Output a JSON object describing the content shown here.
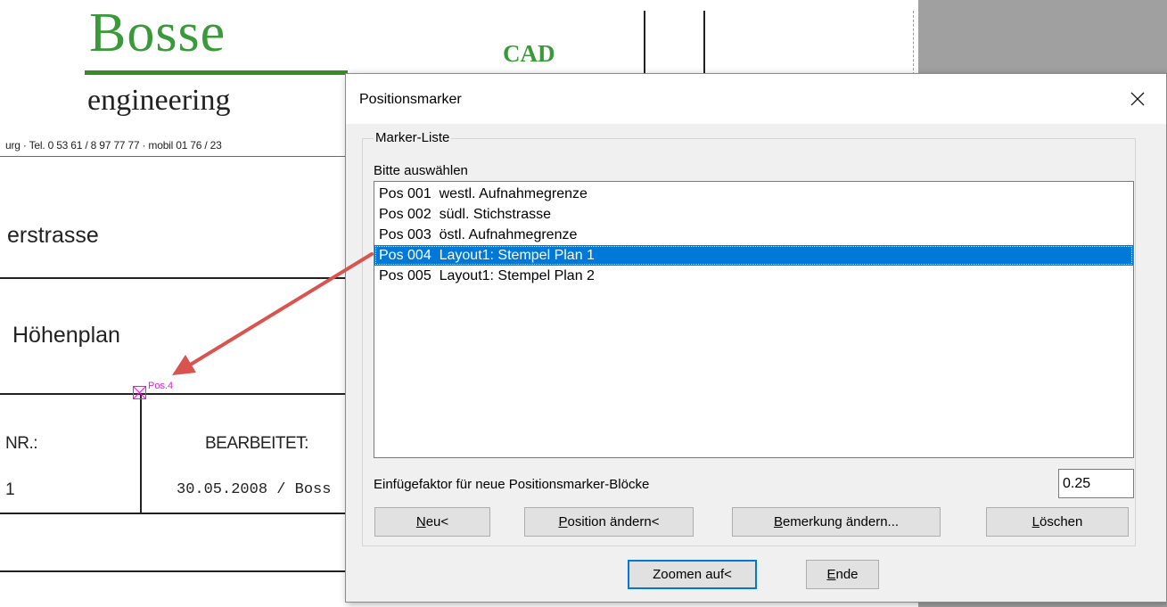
{
  "background": {
    "logo_name": "Bosse",
    "logo_cad": "CAD",
    "logo_sub": "engineering",
    "address": "urg · Tel. 0 53 61 / 8 97  77 77 · mobil 01 76 / 23",
    "street": "erstrasse",
    "plan_title": "Höhenplan",
    "nr_label": "NR.:",
    "nr_value": "1",
    "bearbeitet_label": "BEARBEITET:",
    "bearbeitet_value": "30.05.2008 / Boss",
    "marker_label": "Pos.4",
    "colors": {
      "logo_green": "#3a9a3a",
      "marker_magenta": "#e020e0",
      "arrow_red": "#d9534f"
    }
  },
  "dialog": {
    "title": "Positionsmarker",
    "group_label": "Marker-Liste",
    "list_label": "Bitte auswählen",
    "items": [
      "Pos 001  westl. Aufnahmegrenze",
      "Pos 002  südl. Stichstrasse",
      "Pos 003  östl. Aufnahmegrenze",
      "Pos 004  Layout1: Stempel Plan 1",
      "Pos 005  Layout1: Stempel Plan 2"
    ],
    "selected_index": 3,
    "factor_label": "Einfügefaktor für neue Positionsmarker-Blöcke",
    "factor_value": "0.25",
    "buttons": {
      "neu_mnemonic": "N",
      "neu_rest": "eu<",
      "position_mnemonic": "P",
      "position_rest": "osition ändern<",
      "bemerkung_mnemonic": "B",
      "bemerkung_rest": "emerkung ändern...",
      "loeschen_mnemonic": "L",
      "loeschen_rest": "öschen",
      "zoom": "Zoomen auf<",
      "ende_mnemonic": "E",
      "ende_rest": "nde"
    },
    "accent_color": "#0078d7"
  }
}
